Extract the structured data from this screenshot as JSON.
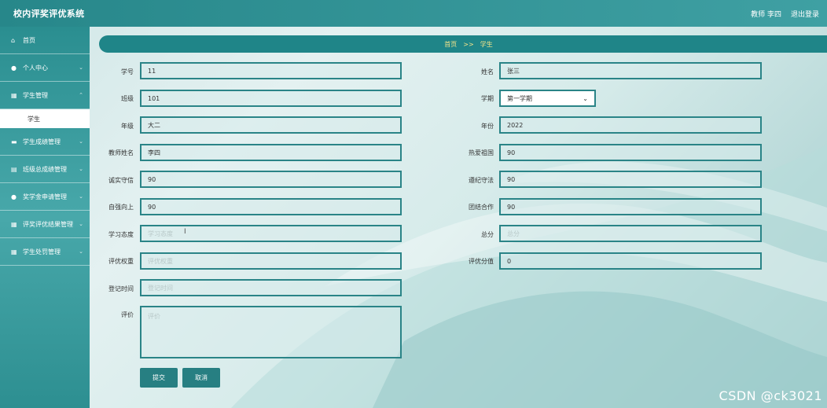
{
  "header": {
    "title": "校内评奖评优系统",
    "user": "教师 李四",
    "logout": "退出登录"
  },
  "sidebar": {
    "items": [
      {
        "label": "首页",
        "icon": "home-icon",
        "glyph": "⌂"
      },
      {
        "label": "个人中心",
        "icon": "user-icon",
        "glyph": "●"
      },
      {
        "label": "学生管理",
        "icon": "grid-icon",
        "glyph": "▦",
        "sub": "学生"
      },
      {
        "label": "学生成绩管理",
        "icon": "chat-icon",
        "glyph": "▬"
      },
      {
        "label": "班级总成绩管理",
        "icon": "doc-icon",
        "glyph": "▤"
      },
      {
        "label": "奖学金申请管理",
        "icon": "user-icon",
        "glyph": "●"
      },
      {
        "label": "评奖评优结果管理",
        "icon": "grid-icon",
        "glyph": "▦"
      },
      {
        "label": "学生处罚管理",
        "icon": "grid-icon",
        "glyph": "▦"
      }
    ]
  },
  "breadcrumb": {
    "home": "首页",
    "sep": ">>",
    "current": "学生"
  },
  "form": {
    "xuehao": {
      "label": "学号",
      "value": "11"
    },
    "xingming": {
      "label": "姓名",
      "value": "张三"
    },
    "banji": {
      "label": "班级",
      "value": "101"
    },
    "xueqi": {
      "label": "学期",
      "value": "第一学期"
    },
    "nianji": {
      "label": "年级",
      "value": "大二"
    },
    "nianfen": {
      "label": "年份",
      "value": "2022"
    },
    "jiaoshi": {
      "label": "教师姓名",
      "value": "李四"
    },
    "reai": {
      "label": "热爱祖国",
      "value": "90"
    },
    "chengshi": {
      "label": "诚实守信",
      "value": "90"
    },
    "zunji": {
      "label": "遵纪守法",
      "value": "90"
    },
    "ziqiang": {
      "label": "自强向上",
      "value": "90"
    },
    "tuanjie": {
      "label": "团结合作",
      "value": "90"
    },
    "xuexi": {
      "label": "学习态度",
      "placeholder": "学习态度"
    },
    "zongfen": {
      "label": "总分",
      "placeholder": "总分"
    },
    "quanzhong": {
      "label": "评优权重",
      "placeholder": "评优权重"
    },
    "fenzhi": {
      "label": "评优分值",
      "value": "0"
    },
    "dengji": {
      "label": "登记时间",
      "placeholder": "登记时间"
    },
    "pingjia": {
      "label": "评价",
      "placeholder": "评价"
    }
  },
  "buttons": {
    "submit": "提交",
    "cancel": "取消"
  },
  "watermark": "CSDN @ck3021",
  "colors": {
    "primary": "#1f8588",
    "breadcrumb_text": "#f4e48a"
  }
}
